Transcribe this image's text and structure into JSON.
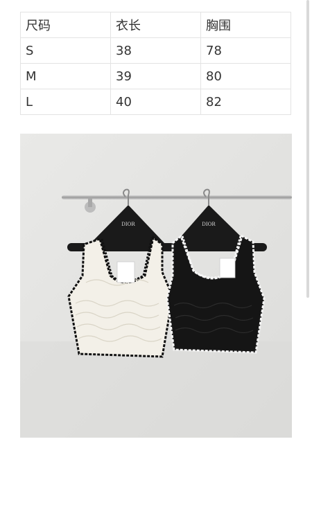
{
  "size_table": {
    "headers": [
      "尺码",
      "衣长",
      "胸围"
    ],
    "rows": [
      [
        "S",
        "38",
        "78"
      ],
      [
        "M",
        "39",
        "80"
      ],
      [
        "L",
        "40",
        "82"
      ]
    ]
  },
  "photo": {
    "hanger_brand": "DIOR"
  },
  "colors": {
    "table_border": "#e3e3e3",
    "text": "#333333",
    "wall": "#e6e6e4",
    "knit_white": "#f3f0e8",
    "knit_black": "#151515"
  }
}
